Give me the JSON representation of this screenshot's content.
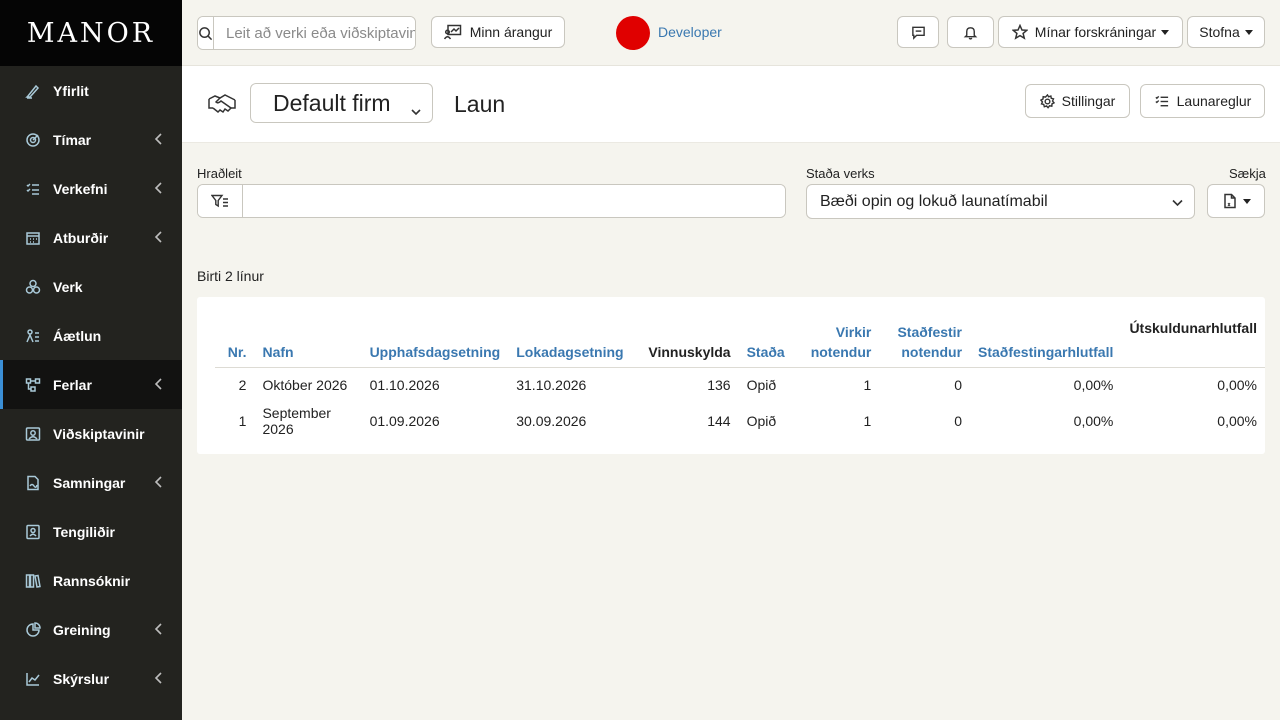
{
  "sidebar": {
    "logo": "MANOR",
    "items": [
      {
        "label": "Yfirlit",
        "icon": "pen-icon",
        "chevron": false
      },
      {
        "label": "Tímar",
        "icon": "clock-target-icon",
        "chevron": true
      },
      {
        "label": "Verkefni",
        "icon": "checklist-icon",
        "chevron": true
      },
      {
        "label": "Atburðir",
        "icon": "calendar-icon",
        "chevron": true
      },
      {
        "label": "Verk",
        "icon": "cubes-icon",
        "chevron": false
      },
      {
        "label": "Áætlun",
        "icon": "plan-icon",
        "chevron": false
      },
      {
        "label": "Ferlar",
        "icon": "workflow-icon",
        "chevron": true,
        "active": true
      },
      {
        "label": "Viðskiptavinir",
        "icon": "client-icon",
        "chevron": false
      },
      {
        "label": "Samningar",
        "icon": "contract-icon",
        "chevron": true
      },
      {
        "label": "Tengiliðir",
        "icon": "contact-icon",
        "chevron": false
      },
      {
        "label": "Rannsóknir",
        "icon": "books-icon",
        "chevron": false
      },
      {
        "label": "Greining",
        "icon": "pie-chart-icon",
        "chevron": true
      },
      {
        "label": "Skýrslur",
        "icon": "line-chart-icon",
        "chevron": true
      }
    ]
  },
  "topbar": {
    "search_placeholder": "Leit að verki eða viðskiptavini",
    "achievements_label": "Minn árangur",
    "user_name": "Developer",
    "avatar_color": "#e00000",
    "registrations_label": "Mínar forskráningar",
    "create_label": "Stofna"
  },
  "header": {
    "firm": "Default firm",
    "title": "Laun",
    "settings_label": "Stillingar",
    "payrules_label": "Launareglur"
  },
  "filters": {
    "quicksearch_label": "Hraðleit",
    "quicksearch_value": "",
    "status_label": "Staða verks",
    "status_value": "Bæði opin og lokuð launatímabil",
    "download_label": "Sækja"
  },
  "table": {
    "rows_info": "Birti 2 línur",
    "headers": {
      "nr": "Nr.",
      "name": "Nafn",
      "start": "Upphafsdagsetning",
      "end": "Lokadagsetning",
      "workload": "Vinnuskylda",
      "status": "Staða",
      "active_users_1": "Virkir",
      "active_users_2": "notendur",
      "confirmed_users_1": "Staðfestir",
      "confirmed_users_2": "notendur",
      "confirmation_ratio": "Staðfestingarhlutfall",
      "billing_ratio": "Útskuldunarhlutfall"
    },
    "rows": [
      {
        "nr": "2",
        "name": "Október 2026",
        "start": "01.10.2026",
        "end": "31.10.2026",
        "workload": "136",
        "status": "Opið",
        "active": "1",
        "confirmed": "0",
        "conf_ratio": "0,00%",
        "bill_ratio": "0,00%"
      },
      {
        "nr": "1",
        "name": "September 2026",
        "start": "01.09.2026",
        "end": "30.09.2026",
        "workload": "144",
        "status": "Opið",
        "active": "1",
        "confirmed": "0",
        "conf_ratio": "0,00%",
        "bill_ratio": "0,00%"
      }
    ]
  },
  "colors": {
    "accent": "#3a78b0",
    "sidebar_bg": "#23231f",
    "active_bar": "#3b8fd6"
  }
}
